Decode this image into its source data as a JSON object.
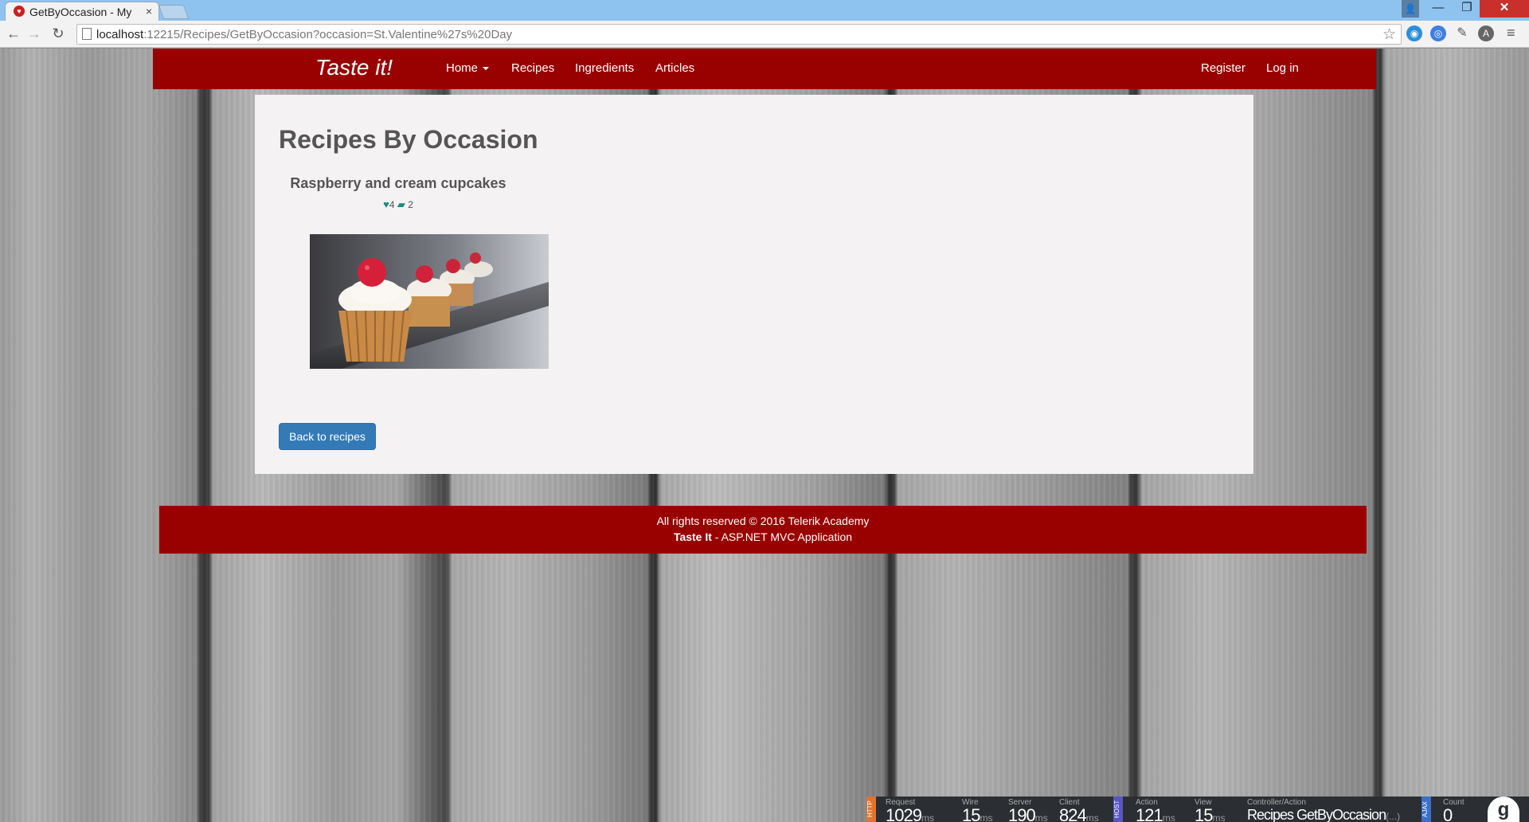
{
  "browser": {
    "tab_title": "GetByOccasion - My",
    "tab_close": "×",
    "url_host": "localhost",
    "url_rest": ":12215/Recipes/GetByOccasion?occasion=St.Valentine%27s%20Day",
    "icons": {
      "back": "←",
      "forward": "→",
      "reload": "↻",
      "star": "☆",
      "menu": "≡",
      "window_user": "👤",
      "minimize": "—",
      "maximize": "❐",
      "close": "✕"
    }
  },
  "navbar": {
    "brand": "Taste it!",
    "links": {
      "home": "Home",
      "recipes": "Recipes",
      "ingredients": "Ingredients",
      "articles": "Articles",
      "register": "Register",
      "login": "Log in"
    }
  },
  "main": {
    "page_title": "Recipes By Occasion",
    "recipe": {
      "title": "Raspberry and cream cupcakes",
      "likes": "4",
      "comments": "2",
      "heart_icon": "♥",
      "comment_icon": "▰"
    },
    "back_button": "Back to recipes"
  },
  "footer": {
    "line1": "All rights reserved © 2016 Telerik Academy",
    "brand": "Taste It",
    "line2_rest": " - ASP.NET MVC Application"
  },
  "glimpse": {
    "tags": {
      "http": "HTTP",
      "host": "HOST",
      "ajax": "AJAX"
    },
    "request": {
      "label": "Request",
      "value": "1029",
      "unit": "ms"
    },
    "wire": {
      "label": "Wire",
      "value": "15",
      "unit": "ms"
    },
    "server": {
      "label": "Server",
      "value": "190",
      "unit": "ms"
    },
    "client": {
      "label": "Client",
      "value": "824",
      "unit": "ms"
    },
    "action": {
      "label": "Action",
      "value": "121",
      "unit": "ms"
    },
    "view": {
      "label": "View",
      "value": "15",
      "unit": "ms"
    },
    "controller": {
      "label": "Controller/Action",
      "value": "Recipes GetByOccasion",
      "suffix": "(...)"
    },
    "count": {
      "label": "Count",
      "value": "0"
    },
    "logo": "g"
  }
}
